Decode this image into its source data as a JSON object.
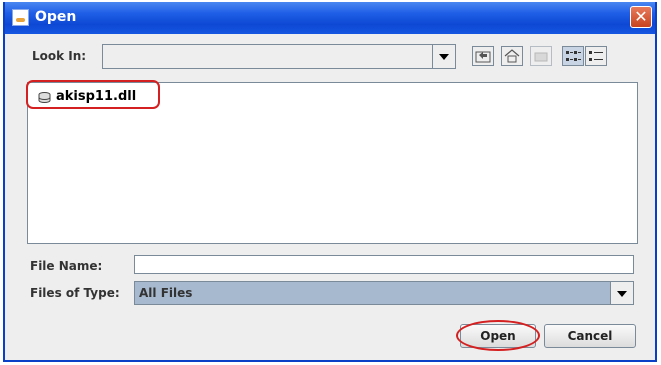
{
  "window": {
    "title": "Open",
    "close_symbol": "✕"
  },
  "lookin": {
    "label": "Look In:",
    "value": ""
  },
  "toolbar": {
    "buttons": [
      {
        "name": "up-one-level-icon"
      },
      {
        "name": "home-icon"
      },
      {
        "name": "new-folder-icon"
      },
      {
        "name": "list-view-icon"
      },
      {
        "name": "details-view-icon"
      }
    ]
  },
  "files": [
    {
      "name": "akisp11.dll",
      "icon": "disk-drive-icon"
    }
  ],
  "filename": {
    "label": "File Name:",
    "value": ""
  },
  "filetype": {
    "label": "Files of Type:",
    "value": "All Files"
  },
  "buttons": {
    "open": "Open",
    "cancel": "Cancel"
  },
  "colors": {
    "title_bar": "#0d48d4",
    "annotation": "#d42020",
    "selection": "#a7b9cf"
  }
}
